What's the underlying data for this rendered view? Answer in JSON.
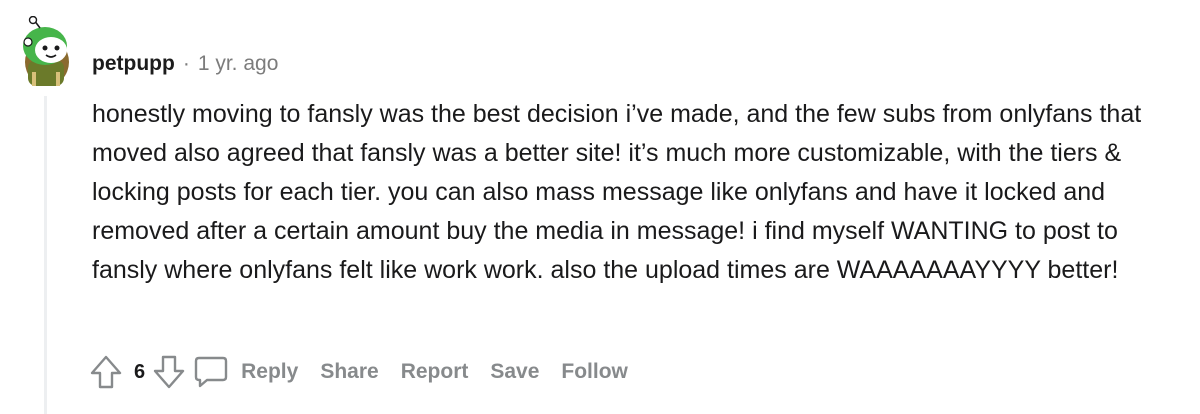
{
  "comment": {
    "username": "petpupp",
    "separator": "·",
    "timestamp": "1 yr. ago",
    "body": "honestly moving to fansly was the best decision i’ve made, and the few subs from onlyfans that moved also agreed that fansly was a better site! it’s much more customizable, with the tiers & locking posts for each tier. you can also mass message like onlyfans and have it locked and removed after a certain amount buy the media in message! i find myself WANTING to post to fansly where onlyfans felt like work work. also the upload times are WAAAAAAAYYYY better!",
    "vote_count": "6"
  },
  "actions": {
    "reply_label": "Reply",
    "share_label": "Share",
    "report_label": "Report",
    "save_label": "Save",
    "follow_label": "Follow"
  },
  "icons": {
    "avatar": "snoo-avatar-icon",
    "upvote": "upvote-arrow-icon",
    "downvote": "downvote-arrow-icon",
    "reply": "comment-bubble-icon"
  },
  "colors": {
    "action_gray": "#878a8c",
    "avatar_green": "#46b54a",
    "thread_line": "#edeff1"
  }
}
